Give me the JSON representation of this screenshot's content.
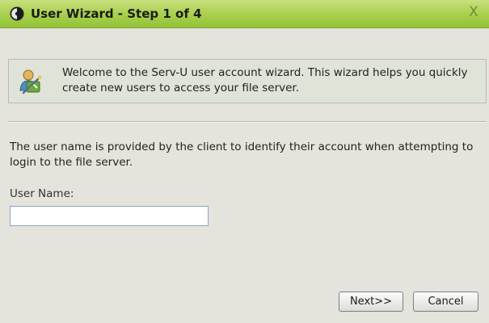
{
  "window": {
    "title": "User Wizard - Step 1 of 4",
    "close_glyph": "X",
    "app_icon": "serv-u-icon",
    "close_icon": "close-icon"
  },
  "welcome": {
    "icon": "user-wizard-icon",
    "text": "Welcome to the Serv-U user account wizard. This wizard helps you quickly create new users to access your file server."
  },
  "body": {
    "description": "The user name is provided by the client to identify their account when attempting to login to the file server.",
    "user_name_label": "User Name:",
    "user_name_value": ""
  },
  "buttons": {
    "next_label": "Next>>",
    "cancel_label": "Cancel"
  },
  "colors": {
    "titlebar": "#a6cf4a",
    "background": "#e4e4dc"
  }
}
